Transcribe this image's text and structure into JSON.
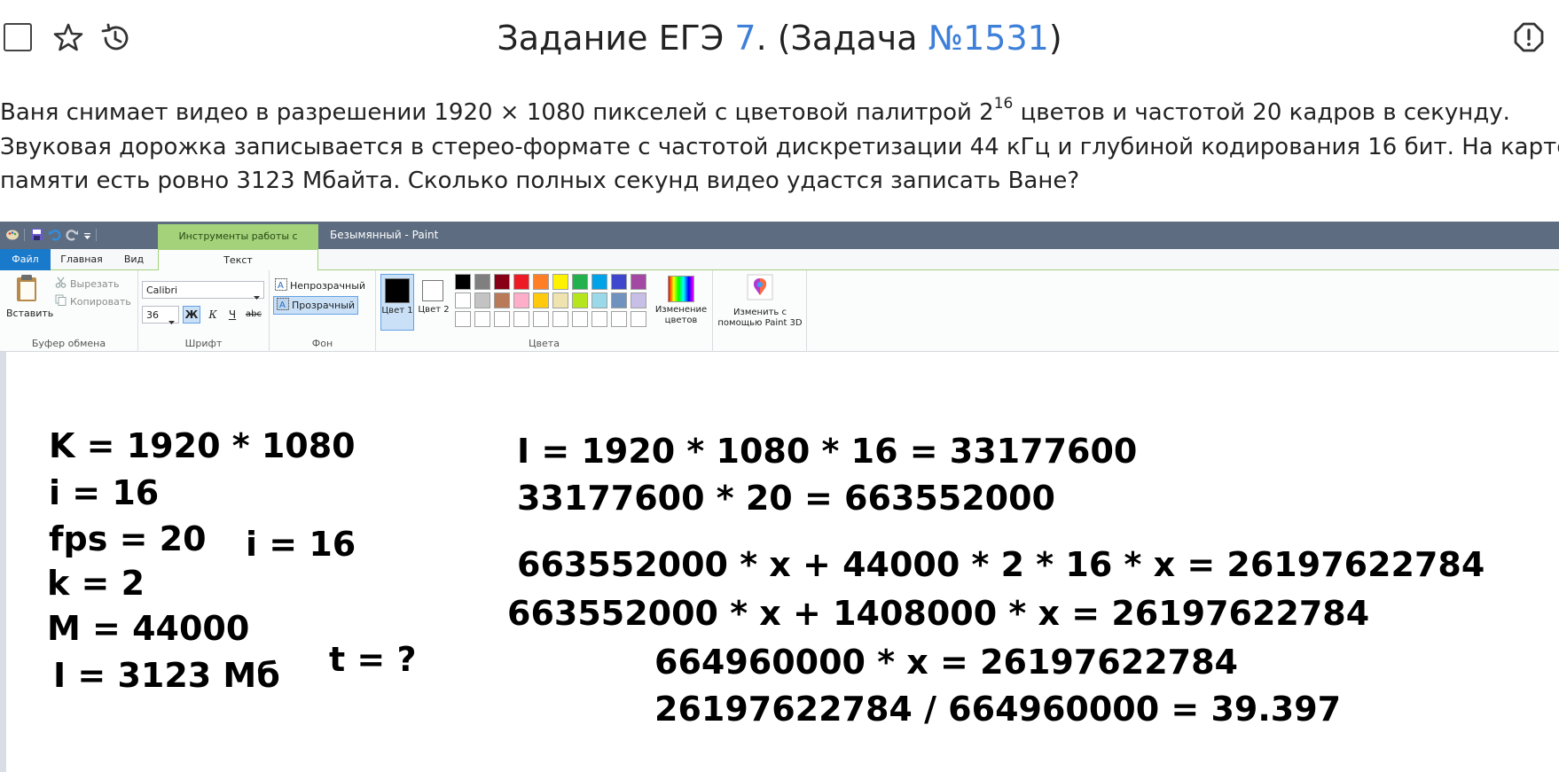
{
  "header": {
    "title_prefix": "Задание ЕГЭ ",
    "task_number": "7",
    "title_middle": ". (Задача ",
    "problem_number": "№1531",
    "title_suffix": ")",
    "icons": [
      "checkbox",
      "star-icon",
      "history-icon",
      "report-icon"
    ]
  },
  "statement": {
    "line1_a": "Ваня снимает видео в разрешении 1920 × 1080 пикселей с цветовой палитрой 2",
    "line1_sup": "16",
    "line1_b": " цветов и частотой 20 кадров в секунду.",
    "line2": "Звуковая дорожка записывается в стерео-формате с частотой дискретизации 44 кГц и глубиной кодирования 16 бит. На карте",
    "line3": "памяти есть ровно 3123 Мбайта. Сколько полных секунд видео удастся записать Ване?"
  },
  "paint": {
    "context_tab": "Инструменты работы с текстом",
    "window_title": "Безымянный - Paint",
    "tabs": {
      "file": "Файл",
      "home": "Главная",
      "view": "Вид",
      "text": "Текст"
    },
    "clipboard": {
      "paste": "Вставить",
      "cut": "Вырезать",
      "copy": "Копировать",
      "label": "Буфер обмена"
    },
    "font": {
      "family": "Calibri",
      "size": "36",
      "bold": "Ж",
      "italic": "К",
      "underline": "Ч",
      "strike": "abc",
      "label": "Шрифт"
    },
    "background": {
      "opaque": "Непрозрачный",
      "transparent": "Прозрачный",
      "label": "Фон"
    },
    "colors": {
      "color1": "Цвет 1",
      "color2": "Цвет 2",
      "edit": "Изменение цветов",
      "label": "Цвета",
      "paint3d": "Изменить с помощью Paint 3D",
      "row1": [
        "#000000",
        "#7f7f7f",
        "#880015",
        "#ed1c24",
        "#ff7f27",
        "#fff200",
        "#22b14c",
        "#00a2e8",
        "#3f48cc",
        "#a349a4"
      ],
      "row2": [
        "#ffffff",
        "#c3c3c3",
        "#b97a57",
        "#ffaec9",
        "#ffc90e",
        "#efe4b0",
        "#b5e61d",
        "#99d9ea",
        "#7092be",
        "#c8bfe7"
      ]
    },
    "canvas_text": {
      "left": [
        "K = 1920 * 1080",
        "i = 16",
        "fps = 20",
        "k = 2",
        "M = 44000",
        "I = 3123 Мб"
      ],
      "mid_i": "i = 16",
      "mid_t": "t = ?",
      "right": [
        "I = 1920 * 1080 * 16 = 33177600",
        "33177600 * 20 = 663552000",
        "663552000 * x + 44000 * 2 * 16 * x = 26197622784",
        "663552000 * x + 1408000 * x = 26197622784",
        "664960000 * x = 26197622784",
        "26197622784 / 664960000  = 39.397"
      ]
    }
  }
}
